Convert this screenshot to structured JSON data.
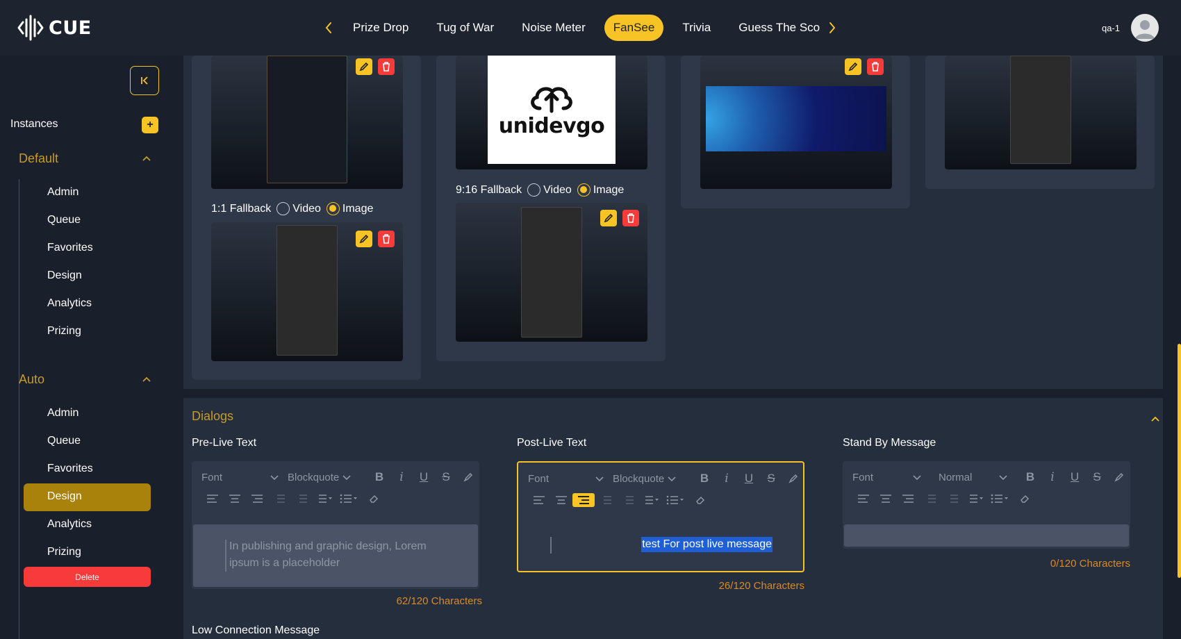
{
  "app": {
    "logo_text": "CUE",
    "user_name": "qa-1"
  },
  "tabs": [
    {
      "label": "Prize Drop",
      "active": false
    },
    {
      "label": "Tug of War",
      "active": false
    },
    {
      "label": "Noise Meter",
      "active": false
    },
    {
      "label": "FanSee",
      "active": true
    },
    {
      "label": "Trivia",
      "active": false
    },
    {
      "label": "Guess The Sco",
      "active": false
    }
  ],
  "sidebar": {
    "instances_label": "Instances",
    "groups": [
      {
        "title": "Default",
        "items": [
          "Admin",
          "Queue",
          "Favorites",
          "Design",
          "Analytics",
          "Prizing"
        ]
      },
      {
        "title": "Auto",
        "items": [
          "Admin",
          "Queue",
          "Favorites",
          "Design",
          "Analytics",
          "Prizing"
        ],
        "active_item": "Design"
      }
    ],
    "delete_label": "Delete"
  },
  "media": {
    "logo_text": "unidevgo",
    "fallback_11": {
      "label": "1:1 Fallback",
      "option_video": "Video",
      "option_image": "Image",
      "selected": "Image"
    },
    "fallback_916": {
      "label": "9:16 Fallback",
      "option_video": "Video",
      "option_image": "Image",
      "selected": "Image"
    }
  },
  "dialogs": {
    "title": "Dialogs",
    "pre_live": {
      "label": "Pre-Live Text",
      "font": "Font",
      "block": "Blockquote",
      "text": "In publishing and graphic design, Lorem ipsum is a placeholder",
      "counter": "62/120 Characters"
    },
    "post_live": {
      "label": "Post-Live Text",
      "font": "Font",
      "block": "Blockquote",
      "text": "test For post live message",
      "counter": "26/120 Characters"
    },
    "stand_by": {
      "label": "Stand By Message",
      "font": "Font",
      "block": "Normal",
      "text": "",
      "counter": "0/120 Characters"
    },
    "low_connection_label": "Low Connection Message"
  },
  "colors": {
    "accent": "#f7c325",
    "danger": "#f73a3a",
    "heading": "#c79b2a",
    "counter": "#d98a2a"
  }
}
